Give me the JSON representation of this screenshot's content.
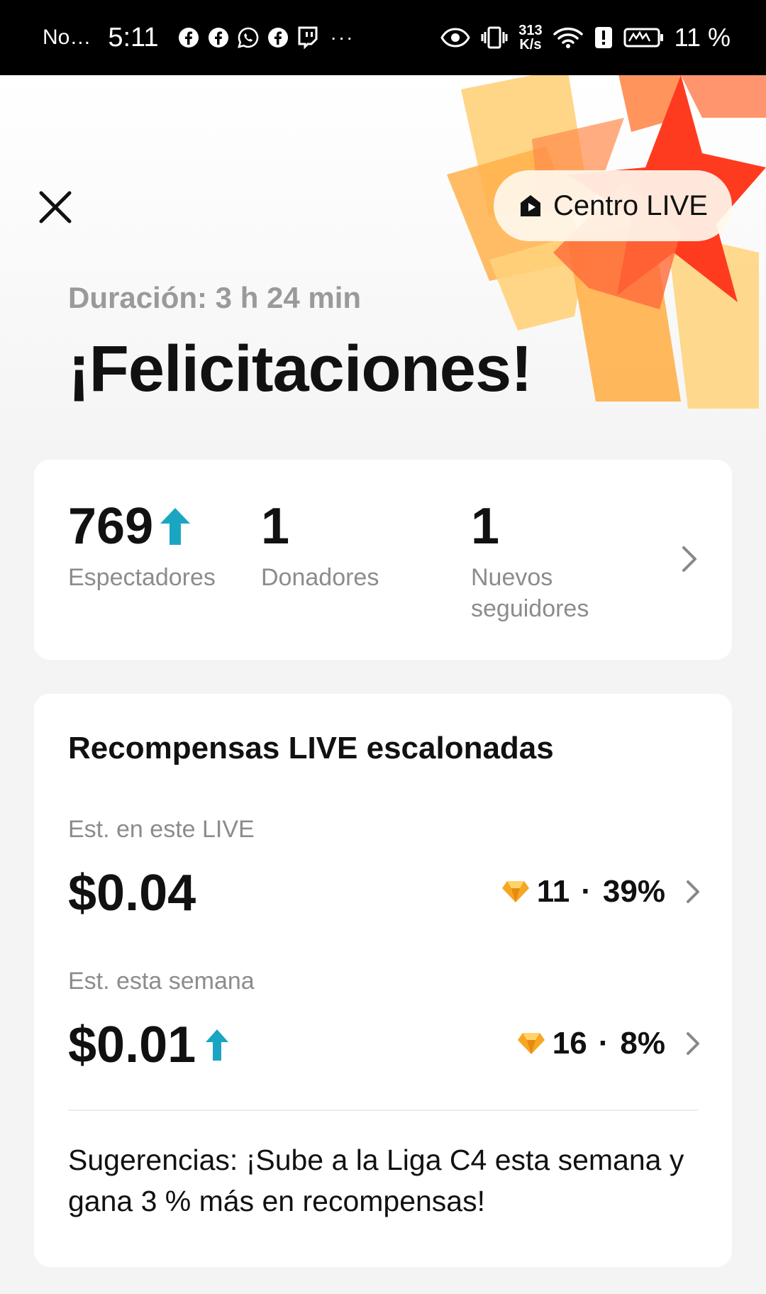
{
  "status_bar": {
    "notification": "No…",
    "time": "5:11",
    "more": "···",
    "speed_value": "313",
    "speed_unit": "K/s",
    "battery": "11 %",
    "icons": [
      "facebook-icon",
      "facebook-icon",
      "whatsapp-icon",
      "facebook-icon",
      "twitch-icon",
      "eye-icon",
      "vibrate-icon",
      "wifi-icon",
      "alert-icon",
      "battery-icon"
    ]
  },
  "header": {
    "live_center_label": "Centro LIVE",
    "duration": "Duración: 3 h 24 min",
    "title": "¡Felicitaciones!"
  },
  "stats": {
    "viewers_value": "769",
    "viewers_label": "Espectadores",
    "donors_value": "1",
    "donors_label": "Donadores",
    "followers_value": "1",
    "followers_label": "Nuevos seguidores"
  },
  "rewards": {
    "title": "Recompensas LIVE escalonadas",
    "this_live_label": "Est. en este LIVE",
    "this_live_amount": "$0.04",
    "this_live_diamonds": "11",
    "this_live_percent": "39%",
    "this_week_label": "Est. esta semana",
    "this_week_amount": "$0.01",
    "this_week_diamonds": "16",
    "this_week_percent": "8%",
    "separator": "·",
    "tips": "Sugerencias: ¡Sube a la Liga C4 esta semana y gana 3 % más en recompensas!"
  },
  "colors": {
    "accent_up_arrow": "#1aa6c2",
    "diamond": "#f5a623",
    "burst_red": "#ff3b1f",
    "burst_orange": "#ffb04a",
    "burst_yellow": "#ffd27a"
  }
}
